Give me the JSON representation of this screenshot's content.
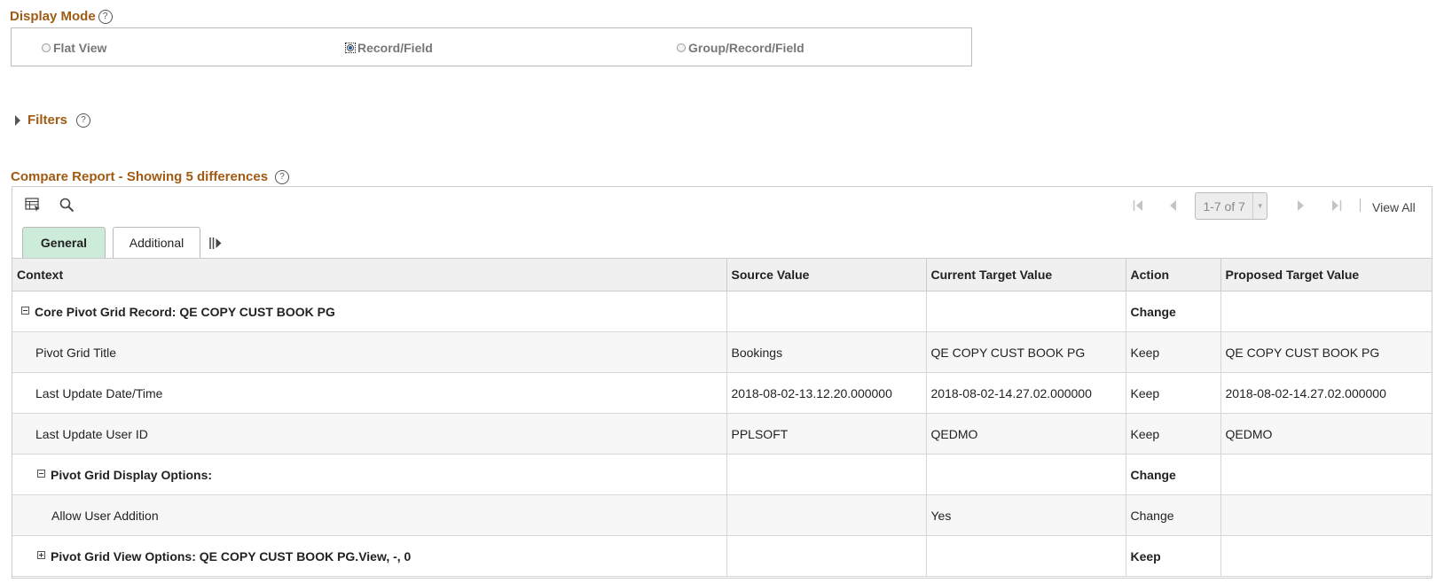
{
  "display_mode": {
    "title": "Display Mode",
    "help_glyph": "?",
    "options": [
      {
        "label": "Flat View",
        "selected": false
      },
      {
        "label": "Record/Field",
        "selected": true
      },
      {
        "label": "Group/Record/Field",
        "selected": false
      }
    ]
  },
  "filters": {
    "title": "Filters",
    "help_glyph": "?",
    "expanded": false
  },
  "report": {
    "title": "Compare Report - Showing 5 differences",
    "help_glyph": "?",
    "toolbar": {
      "personalize_icon": "grid-personalize-icon",
      "search_icon": "search-icon"
    },
    "pager": {
      "range": "1-7 of 7",
      "view_all": "View All"
    },
    "tabs": [
      {
        "label": "General",
        "active": true
      },
      {
        "label": "Additional",
        "active": false
      }
    ],
    "columns": [
      "Context",
      "Source Value",
      "Current Target Value",
      "Action",
      "Proposed Target Value"
    ],
    "rows": [
      {
        "context": "Core Pivot Grid Record: QE COPY CUST BOOK PG",
        "source": "",
        "current": "",
        "action": "Change",
        "proposed": "",
        "bold": true,
        "toggle": "collapse",
        "indent": 0
      },
      {
        "context": "Pivot Grid Title",
        "source": "Bookings",
        "current": "QE COPY CUST BOOK PG",
        "action": "Keep",
        "proposed": "QE COPY CUST BOOK PG",
        "bold": false,
        "toggle": "",
        "indent": 1
      },
      {
        "context": "Last Update Date/Time",
        "source": "2018-08-02-13.12.20.000000",
        "current": "2018-08-02-14.27.02.000000",
        "action": "Keep",
        "proposed": "2018-08-02-14.27.02.000000",
        "bold": false,
        "toggle": "",
        "indent": 1
      },
      {
        "context": "Last Update User ID",
        "source": "PPLSOFT",
        "current": "QEDMO",
        "action": "Keep",
        "proposed": "QEDMO",
        "bold": false,
        "toggle": "",
        "indent": 1
      },
      {
        "context": "Pivot Grid Display Options:",
        "source": "",
        "current": "",
        "action": "Change",
        "proposed": "",
        "bold": true,
        "toggle": "collapse",
        "indent": 1
      },
      {
        "context": "Allow User Addition",
        "source": "",
        "current": "Yes",
        "action": "Change",
        "proposed": "",
        "bold": false,
        "toggle": "",
        "indent": 2
      },
      {
        "context": "Pivot Grid View Options: QE COPY CUST BOOK PG.View, -, 0",
        "source": "",
        "current": "",
        "action": "Keep",
        "proposed": "",
        "bold": true,
        "toggle": "expand",
        "indent": 1
      }
    ]
  },
  "colors": {
    "section_title": "#a15a12",
    "active_tab": "#cdebd9",
    "header_bg": "#f0f0f0"
  }
}
